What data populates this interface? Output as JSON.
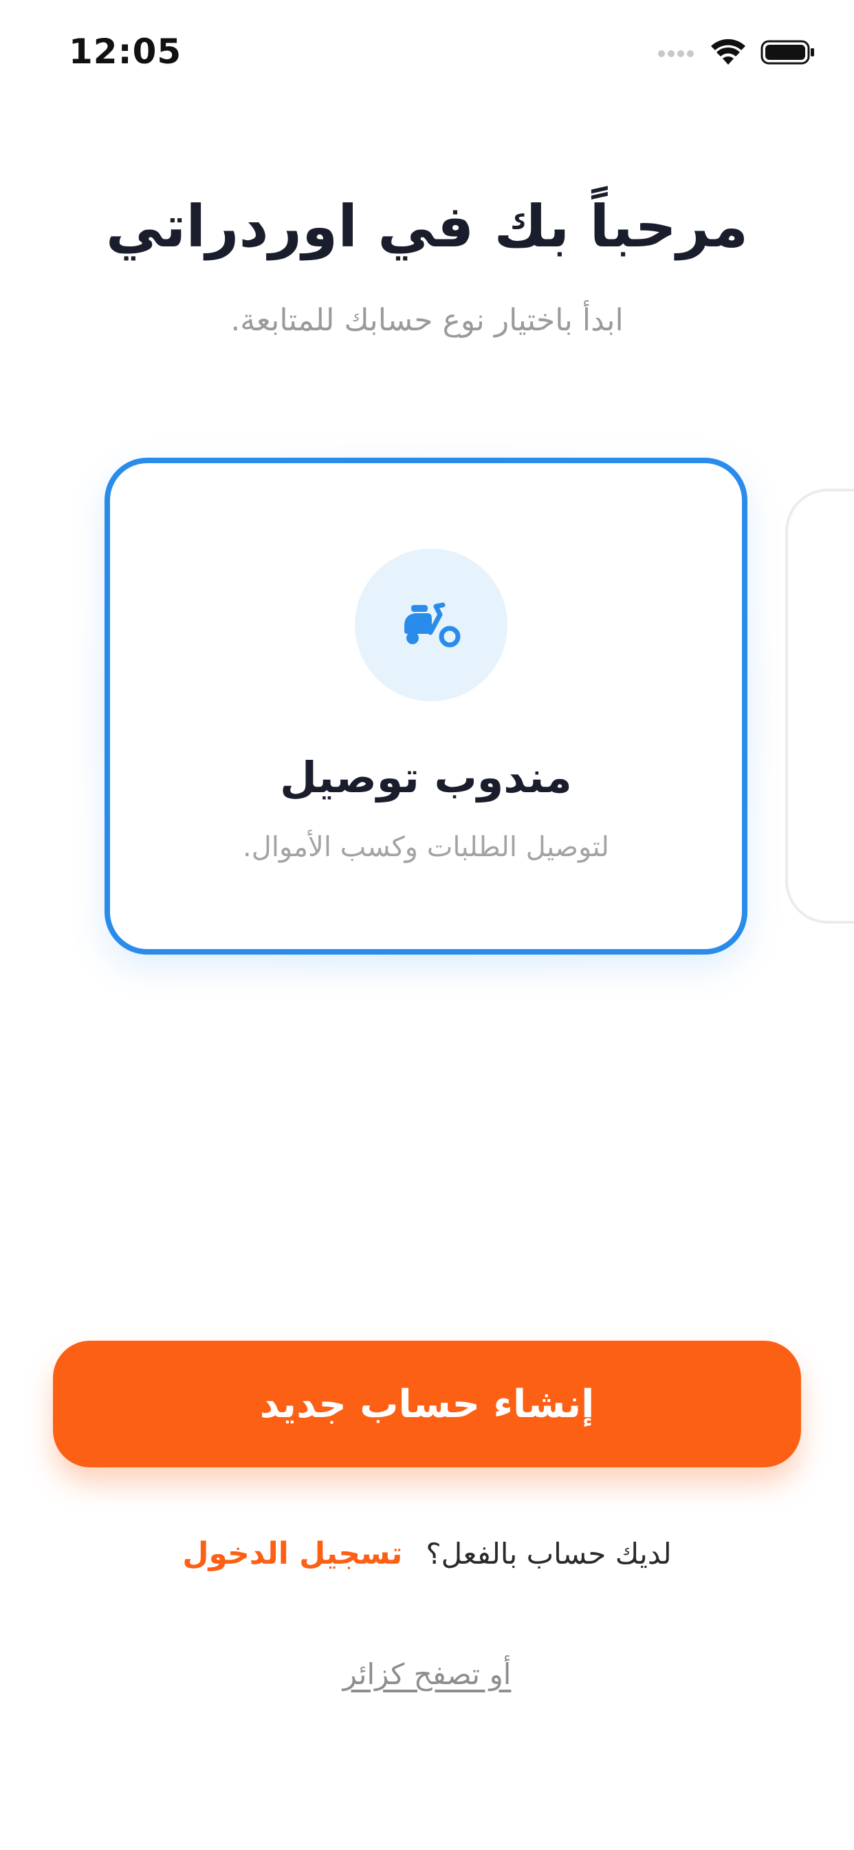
{
  "status_bar": {
    "time": "12:05",
    "icons": [
      "cellular-signal-icon",
      "wifi-icon",
      "battery-icon"
    ]
  },
  "header": {
    "title": "مرحباً بك في اوردراتي",
    "subtitle": "ابدأ باختيار نوع حسابك للمتابعة."
  },
  "account_types": [
    {
      "title": "مندوب توصيل",
      "description": "لتوصيل الطلبات وكسب الأموال.",
      "icon": "scooter-icon",
      "selected": true
    }
  ],
  "actions": {
    "create_account_label": "إنشاء حساب جديد",
    "login_prompt": "لديك حساب بالفعل؟",
    "login_link": "تسجيل الدخول",
    "guest_link": "أو تصفح كزائر"
  },
  "colors": {
    "accent_orange": "#fb6014",
    "accent_blue": "#2a8cea",
    "icon_circle_bg": "#e6f3fd",
    "title_text": "#1a1d2b",
    "muted_text": "#9a9a9a"
  }
}
